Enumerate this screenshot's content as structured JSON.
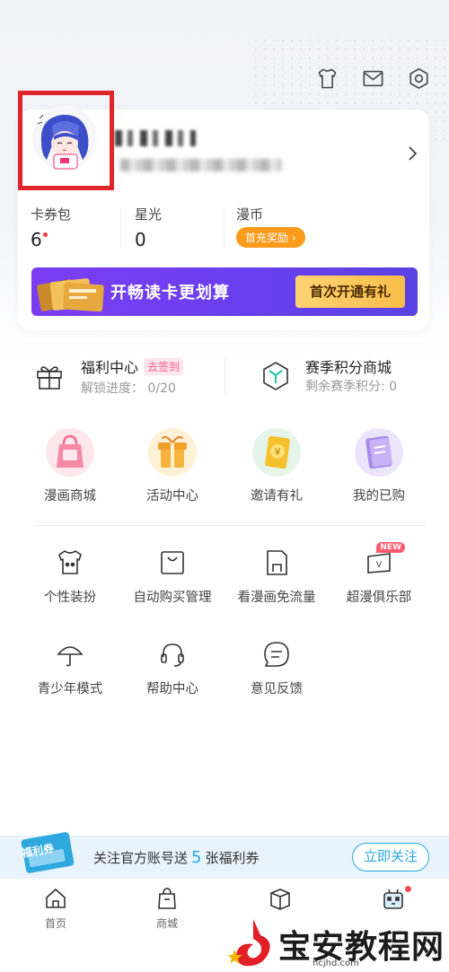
{
  "header": {
    "icons": [
      "tshirt-icon",
      "mail-icon",
      "settings-icon"
    ]
  },
  "profile": {
    "avatar": "anime-avatar",
    "stats": [
      {
        "label": "卡券包",
        "value": "6"
      },
      {
        "label": "星光",
        "value": "0"
      },
      {
        "label": "漫币",
        "button": "首充奖励"
      }
    ],
    "vip_banner": {
      "text": "开畅读卡更划算",
      "button": "首次开通有礼"
    }
  },
  "welfare": {
    "title": "福利中心",
    "badge": "去签到",
    "subtitle": "解锁进度： 0/20"
  },
  "season_shop": {
    "title": "赛季积分商城",
    "subtitle": "剩余赛季积分: 0"
  },
  "featured": [
    {
      "label": "漫画商城",
      "icon": "shopping-bag-icon"
    },
    {
      "label": "活动中心",
      "icon": "gift-box-icon"
    },
    {
      "label": "邀请有礼",
      "icon": "yuan-coin-icon"
    },
    {
      "label": "我的已购",
      "icon": "purchased-book-icon"
    }
  ],
  "services": [
    {
      "label": "个性装扮",
      "icon": "outfit-icon"
    },
    {
      "label": "自动购买管理",
      "icon": "bag-icon"
    },
    {
      "label": "看漫画免流量",
      "icon": "sim-card-icon"
    },
    {
      "label": "超漫俱乐部",
      "icon": "vip-card-icon",
      "badge": "NEW"
    }
  ],
  "services2": [
    {
      "label": "青少年模式",
      "icon": "umbrella-icon"
    },
    {
      "label": "帮助中心",
      "icon": "headset-icon"
    },
    {
      "label": "意见反馈",
      "icon": "feedback-icon"
    }
  ],
  "follow": {
    "ticket": "福利券",
    "prefix": "关注官方账号送",
    "number": "5",
    "suffix": "张福利券",
    "button": "立即关注"
  },
  "tabs": [
    {
      "label": "首页",
      "icon": "home-icon"
    },
    {
      "label": "商城",
      "icon": "store-icon"
    },
    {
      "label": "",
      "icon": "bookshelf-icon"
    },
    {
      "label": "",
      "icon": "profile-robot-icon"
    }
  ],
  "watermark": {
    "text": "宝安教程网",
    "url": "hcjhd.com"
  }
}
